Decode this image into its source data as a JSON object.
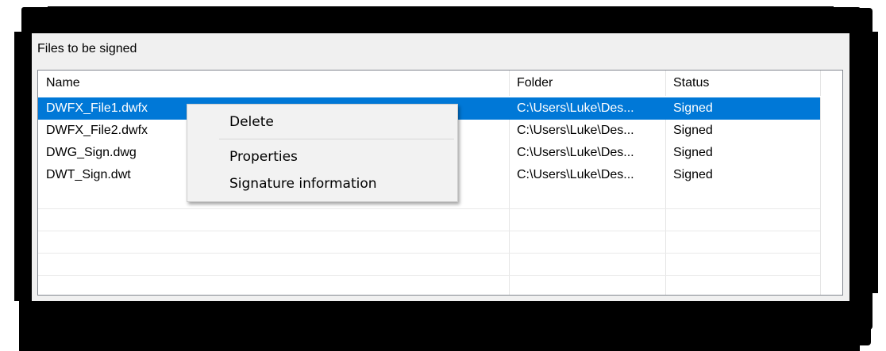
{
  "group": {
    "label": "Files to be signed"
  },
  "columns": {
    "name": "Name",
    "folder": "Folder",
    "status": "Status"
  },
  "files": [
    {
      "name": "DWFX_File1.dwfx",
      "folder": "C:\\Users\\Luke\\Des...",
      "status": "Signed",
      "selected": true
    },
    {
      "name": "DWFX_File2.dwfx",
      "folder": "C:\\Users\\Luke\\Des...",
      "status": "Signed"
    },
    {
      "name": "DWG_Sign.dwg",
      "folder": "C:\\Users\\Luke\\Des...",
      "status": "Signed"
    },
    {
      "name": "DWT_Sign.dwt",
      "folder": "C:\\Users\\Luke\\Des...",
      "status": "Signed"
    }
  ],
  "context_menu": {
    "delete": "Delete",
    "properties": "Properties",
    "signature_info": "Signature information"
  },
  "colors": {
    "selection": "#0078d7",
    "panel": "#f0f0f0"
  }
}
